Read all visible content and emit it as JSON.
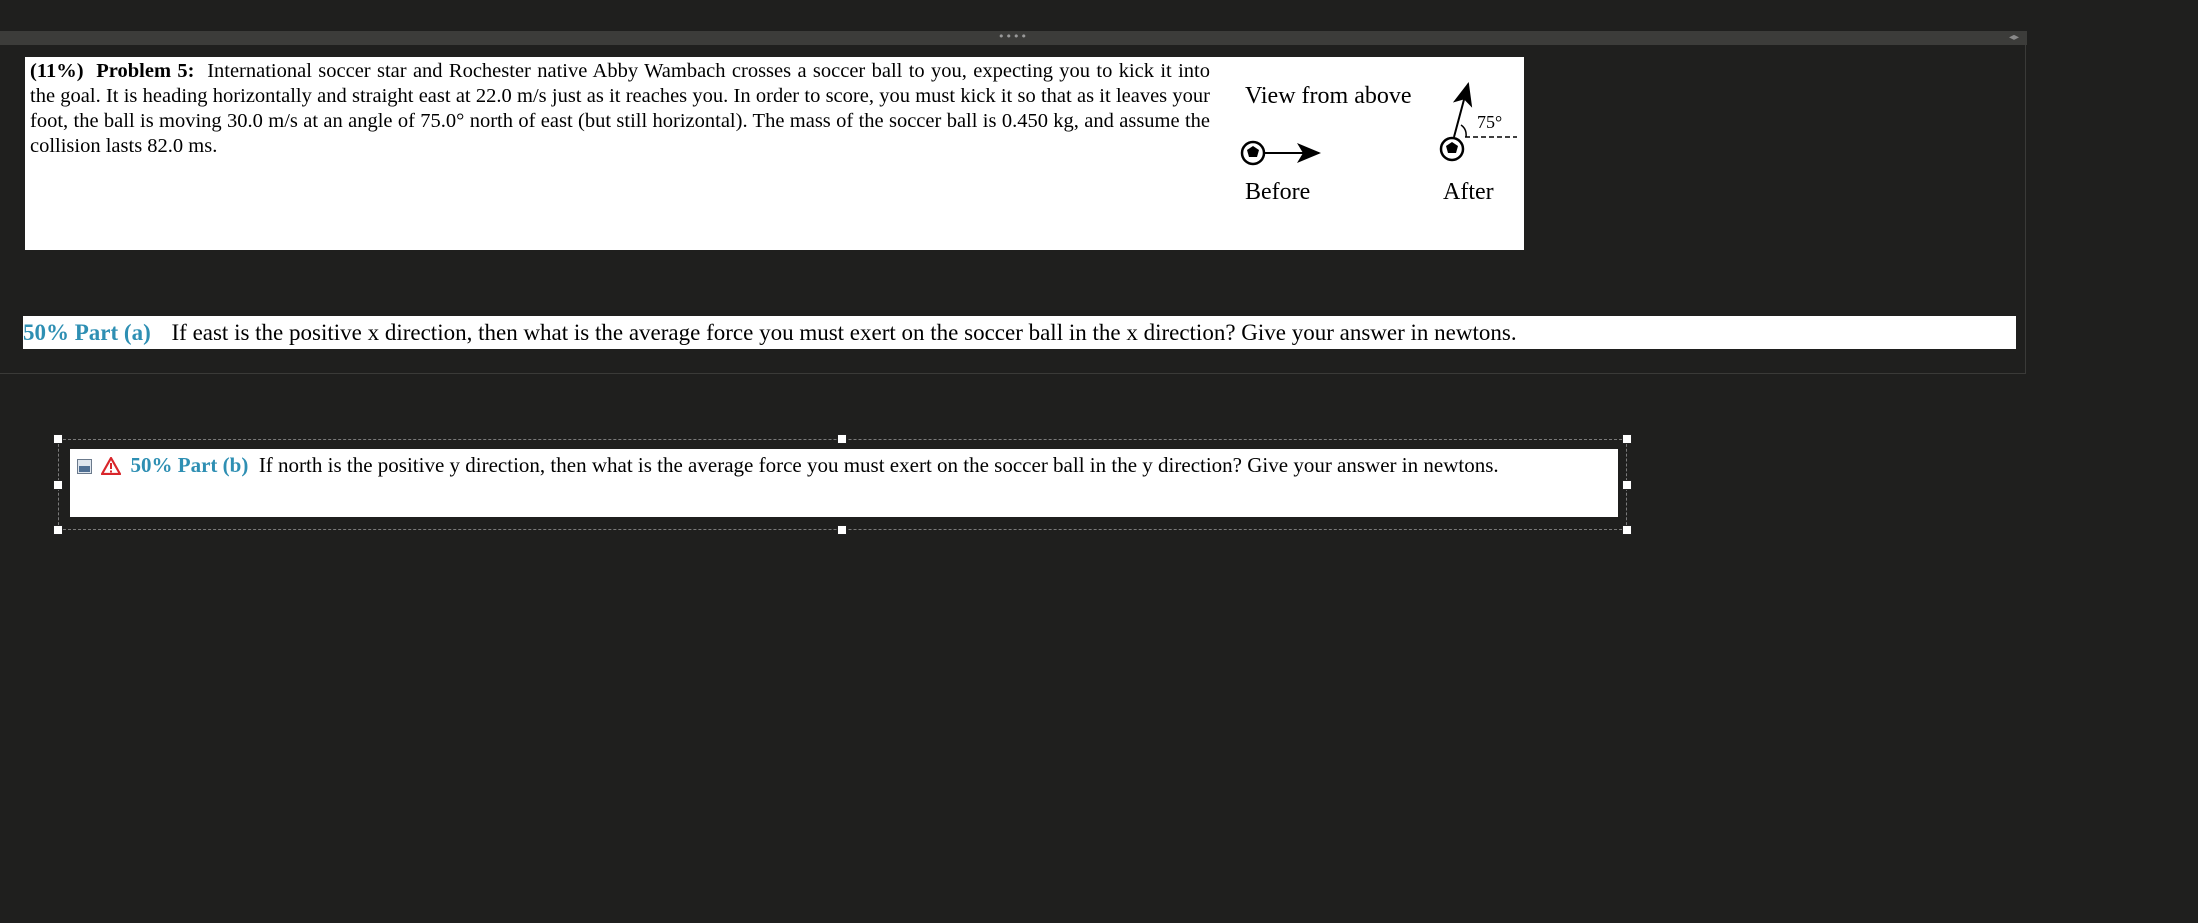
{
  "toolbar": {
    "drag_handle": "••••",
    "collapse": "◂▸"
  },
  "problem": {
    "weight": "(11%)",
    "label": "Problem 5:",
    "text": "International soccer star and Rochester native Abby Wambach crosses a soccer ball to you, expecting you to kick it into the goal. It is heading horizontally and straight east at 22.0 m/s just as it reaches you. In order to score, you must kick it so that as it leaves your foot, the ball is moving 30.0 m/s at an angle of 75.0° north of east (but still horizontal). The mass of the soccer ball is 0.450 kg, and assume the collision lasts 82.0 ms."
  },
  "diagram": {
    "title": "View from above",
    "before_label": "Before",
    "after_label": "After",
    "angle_label": "75°",
    "angle_deg": 75
  },
  "part_a": {
    "percent": "50% Part (a)",
    "text": "If east is the positive x direction, then what is the average force you must exert on the soccer ball in the x direction? Give your answer in newtons."
  },
  "part_b": {
    "percent": "50% Part (b)",
    "text": "If north is the positive y direction, then what is the average force you must exert on the soccer ball in the y direction? Give your answer in newtons.",
    "icons": [
      "image-placeholder-icon",
      "warning-icon"
    ]
  },
  "colors": {
    "background": "#1f1f1e",
    "accent": "#2e8fb3",
    "warning": "#d9262b"
  }
}
